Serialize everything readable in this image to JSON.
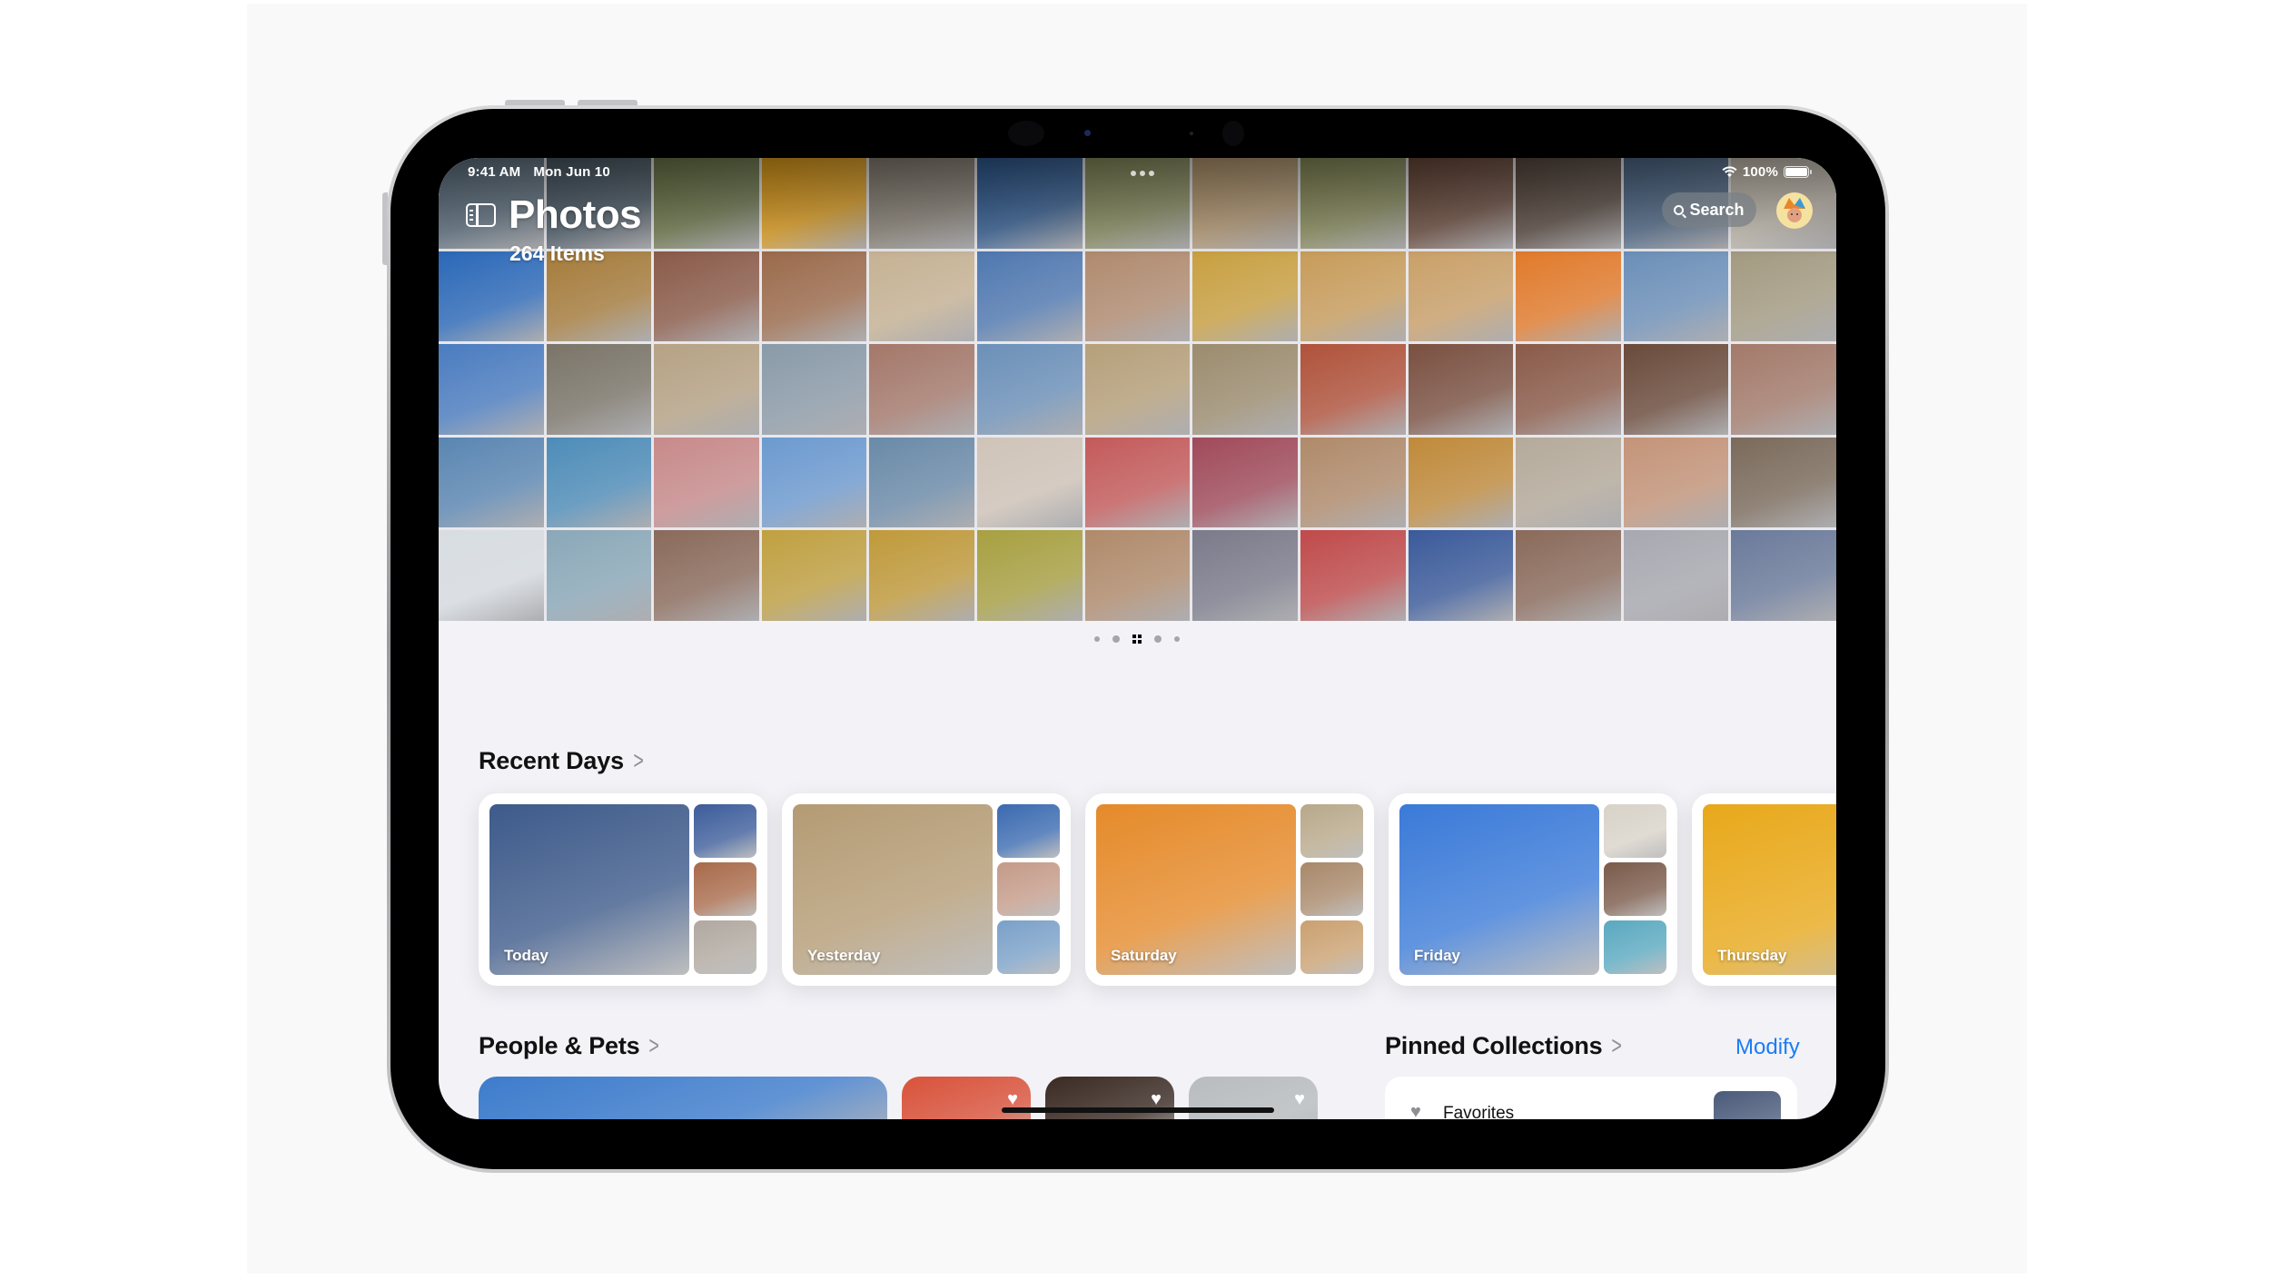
{
  "status_bar": {
    "time": "9:41 AM",
    "date": "Mon Jun 10",
    "battery": "100%",
    "battery_level_pct": 100
  },
  "header": {
    "title": "Photos",
    "item_count": "264 Items",
    "search_label": "Search",
    "icons": {
      "sidebar": "sidebar-toggle-icon",
      "search": "magnifying-glass-icon",
      "avatar": "memoji-avatar",
      "wifi": "wifi-icon",
      "battery": "battery-icon",
      "multitask": "ellipsis-icon"
    }
  },
  "grid": {
    "columns": 13,
    "rows": 5,
    "tiles": [
      "#5d7080",
      "#4a5a66",
      "#6f7a4a",
      "#e8a21a",
      "#8a8275",
      "#2f5c94",
      "#8a8f5d",
      "#b89a70",
      "#8b8e5a",
      "#6b4a3a",
      "#5a4a40",
      "#4f6a8a",
      "#c9c1b3",
      "#2a68b8",
      "#a57b3a",
      "#8a5a48",
      "#9b6a4a",
      "#c6b293",
      "#4f78b0",
      "#b08a6e",
      "#c9a040",
      "#c89c5a",
      "#caa068",
      "#e27a2a",
      "#6b8fb8",
      "#a39a80",
      "#4a7cc0",
      "#7a7468",
      "#b6a284",
      "#8a9aa8",
      "#a4786a",
      "#6b90b8",
      "#b6a07a",
      "#9c8c6e",
      "#b0523a",
      "#7a5040",
      "#8a5a48",
      "#6a4a3a",
      "#a37a6a",
      "#5a86b2",
      "#4d8cb8",
      "#c88a8a",
      "#6c9ad0",
      "#6a8aa8",
      "#d0c4b8",
      "#c45a5a",
      "#a04a5a",
      "#b08a6a",
      "#c08a3a",
      "#b5aa9a",
      "#c49478",
      "#7a6a5a",
      "#d8dde2",
      "#8aa8b8",
      "#8a6a5a",
      "#c0a040",
      "#c09a3a",
      "#a8a040",
      "#b08a6a",
      "#7a7a8a",
      "#c04a4a",
      "#3a5a9a",
      "#8a6a5a",
      "#a8a8b0",
      "#6a7a9a"
    ]
  },
  "page_indicator": {
    "count": 5,
    "active_index": 2
  },
  "recent_days": {
    "title": "Recent Days",
    "days": [
      {
        "label": "Today",
        "main": "#3d5a8a",
        "thumbs": [
          "#3c5c9a",
          "#a86a4a",
          "#b0a8a0"
        ]
      },
      {
        "label": "Yesterday",
        "main": "#b49b74",
        "thumbs": [
          "#3a6ab0",
          "#c49a88",
          "#7aa0c8"
        ]
      },
      {
        "label": "Saturday",
        "main": "#e58a2a",
        "thumbs": [
          "#b8a88a",
          "#a8886a",
          "#caa070"
        ]
      },
      {
        "label": "Friday",
        "main": "#3a7ad8",
        "thumbs": [
          "#d8d2c8",
          "#7a5a4a",
          "#5aa8c0"
        ]
      },
      {
        "label": "Thursday",
        "main": "#e8a81a",
        "thumbs": []
      }
    ]
  },
  "people_pets": {
    "title": "People & Pets",
    "people": [
      {
        "color": "#3d7ccc",
        "favorite": false
      },
      {
        "color": "#d9523a",
        "favorite": true
      },
      {
        "color": "#3a2a22",
        "favorite": true
      },
      {
        "color": "#b8bcbe",
        "favorite": true
      }
    ]
  },
  "pinned_collections": {
    "title": "Pinned Collections",
    "modify_label": "Modify",
    "items": [
      {
        "label": "Favorites",
        "icon": "heart-icon",
        "thumb": "#4a5a7a"
      }
    ]
  },
  "colors": {
    "accent": "#1a7cf5",
    "background": "#f2f2f7",
    "text": "#111111",
    "chevron": "#8e8e93"
  }
}
